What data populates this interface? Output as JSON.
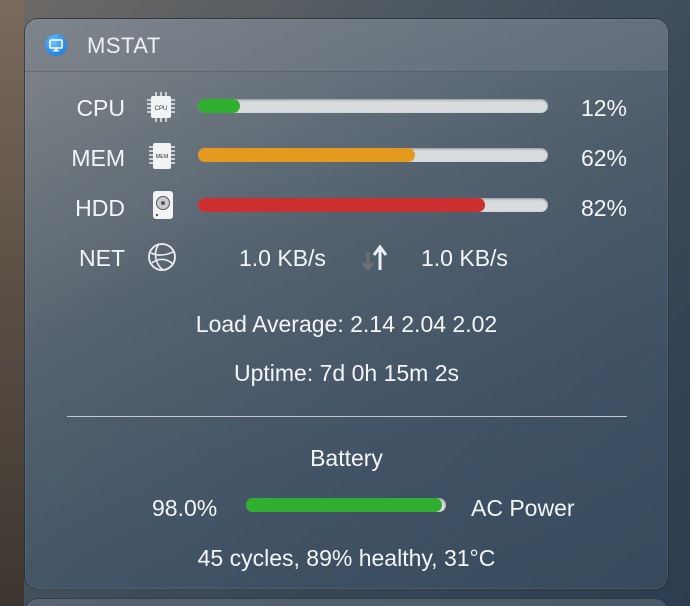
{
  "app": {
    "title": "MSTAT",
    "icon": "monitor-app-icon"
  },
  "stats": {
    "cpu": {
      "label": "CPU",
      "icon": "cpu-chip-icon",
      "chip_text": "CPU",
      "value_text": "12%",
      "fraction": 0.12,
      "color": "#2fae2f"
    },
    "mem": {
      "label": "MEM",
      "icon": "memory-chip-icon",
      "chip_text": "MEM",
      "value_text": "62%",
      "fraction": 0.62,
      "color": "#e49a1e"
    },
    "hdd": {
      "label": "HDD",
      "icon": "hard-disk-icon",
      "value_text": "82%",
      "fraction": 0.82,
      "color": "#cc2f2f"
    }
  },
  "net": {
    "label": "NET",
    "icon": "globe-icon",
    "down": "1.0 KB/s",
    "up": "1.0 KB/s",
    "arrows_icon": "up-down-arrows-icon"
  },
  "load_average": "Load Average: 2.14 2.04 2.02",
  "uptime": "Uptime: 7d 0h 15m 2s",
  "battery": {
    "title": "Battery",
    "percent_text": "98.0%",
    "fraction": 0.98,
    "color": "#2fae2f",
    "source": "AC Power",
    "details": "45 cycles, 89% healthy, 31°C"
  }
}
